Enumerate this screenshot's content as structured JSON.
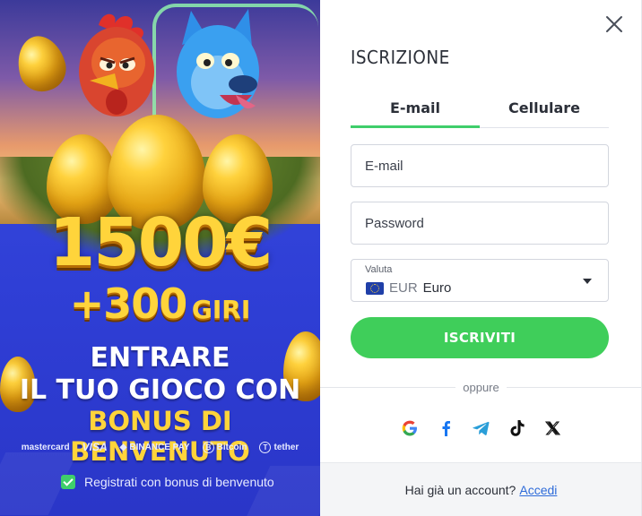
{
  "promo": {
    "amount": "1500€",
    "spins_number": "+300",
    "spins_word": "GIRI",
    "line1": "ENTRARE",
    "line2": "IL TUO GIOCO CON",
    "line3": "BONUS DI BENVENUTO",
    "payments": [
      "mastercard",
      "VISA",
      "BINANCE PAY",
      "Bitcoin",
      "tether"
    ],
    "bonus_checkbox_label": "Registrati con bonus di benvenuto",
    "bonus_checked": true
  },
  "form": {
    "title": "ISCRIZIONE",
    "tabs": [
      "E-mail",
      "Cellulare"
    ],
    "active_tab": "E-mail",
    "email_placeholder": "E-mail",
    "password_placeholder": "Password",
    "currency_label": "Valuta",
    "currency_code": "EUR",
    "currency_name": "Euro",
    "submit_label": "ISCRIVITI",
    "divider_label": "oppure",
    "social_icons": [
      "google-icon",
      "facebook-icon",
      "telegram-icon",
      "tiktok-icon",
      "x-icon"
    ],
    "footer_text": "Hai già un account?",
    "footer_link": "Accedi"
  },
  "colors": {
    "accent_green": "#3fce5a",
    "link_blue": "#2e6bd9",
    "promo_gold": "#ffd43b",
    "promo_blue": "#2f3fd6"
  }
}
